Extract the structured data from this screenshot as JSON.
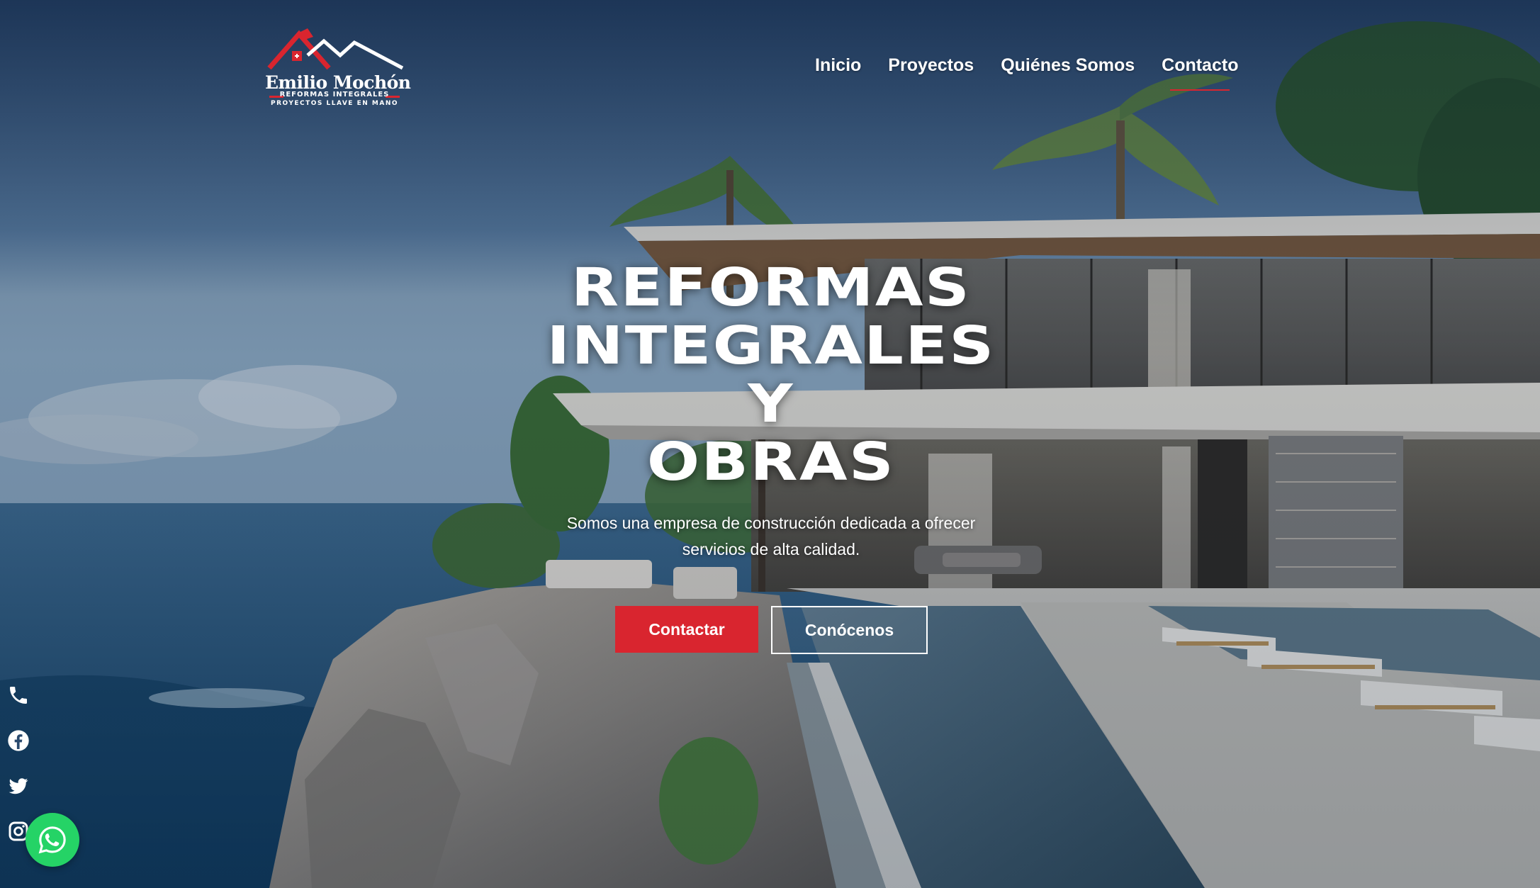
{
  "logo": {
    "name": "Emilio Mochón",
    "line1": "REFORMAS INTEGRALES",
    "line2": "PROYECTOS LLAVE EN MANO"
  },
  "nav": {
    "items": [
      {
        "label": "Inicio",
        "active": false
      },
      {
        "label": "Proyectos",
        "active": false
      },
      {
        "label": "Quiénes Somos",
        "active": false
      },
      {
        "label": "Contacto",
        "active": true
      }
    ]
  },
  "hero": {
    "title_lines": [
      "REFORMAS",
      "INTEGRALES",
      "Y",
      "OBRAS"
    ],
    "subtitle_line1": "Somos una empresa de construcción dedicada a ofrecer",
    "subtitle_line2": "servicios de alta calidad.",
    "primary_button": "Contactar",
    "secondary_button": "Conócenos"
  },
  "social": {
    "icons": [
      "phone-icon",
      "facebook-icon",
      "twitter-icon",
      "instagram-icon"
    ],
    "whatsapp": "whatsapp-icon"
  },
  "colors": {
    "accent": "#d9252f",
    "whatsapp": "#25d366",
    "text": "#ffffff"
  }
}
